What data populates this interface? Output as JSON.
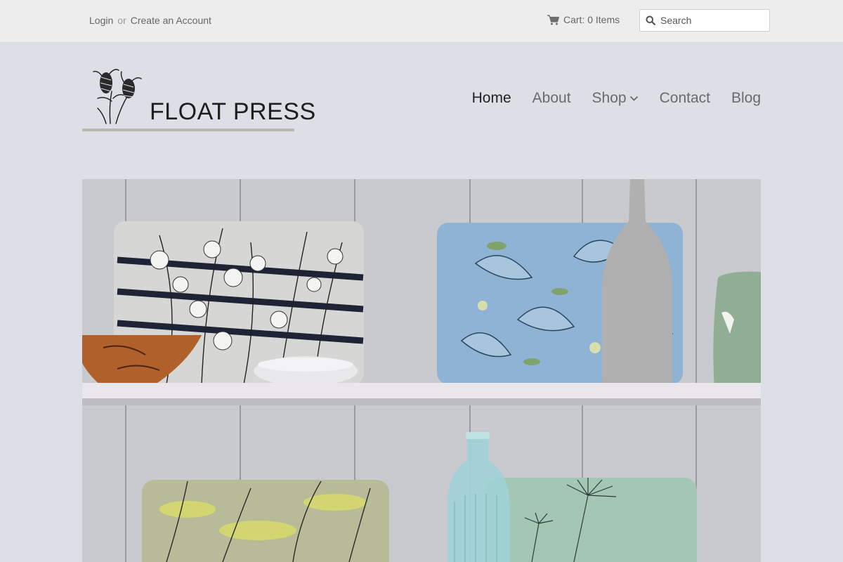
{
  "topbar": {
    "login_label": "Login",
    "or_text": "or",
    "create_account_label": "Create an Account",
    "cart_label": "Cart: 0 Items",
    "cart_icon": "shopping-cart-icon",
    "search_icon": "search-icon",
    "search_placeholder": "Search"
  },
  "logo": {
    "text": "FLOAT PRESS",
    "icon": "teasel-plant-logo"
  },
  "nav": {
    "items": [
      {
        "label": "Home",
        "active": true
      },
      {
        "label": "About"
      },
      {
        "label": "Shop",
        "has_dropdown": true
      },
      {
        "label": "Contact"
      },
      {
        "label": "Blog"
      }
    ],
    "dropdown_icon": "chevron-down-icon"
  },
  "colors": {
    "page_background": "#dcdfe6",
    "topbar_background": "#ededed",
    "nav_active": "#222222",
    "nav_inactive": "#6a6a6a"
  }
}
